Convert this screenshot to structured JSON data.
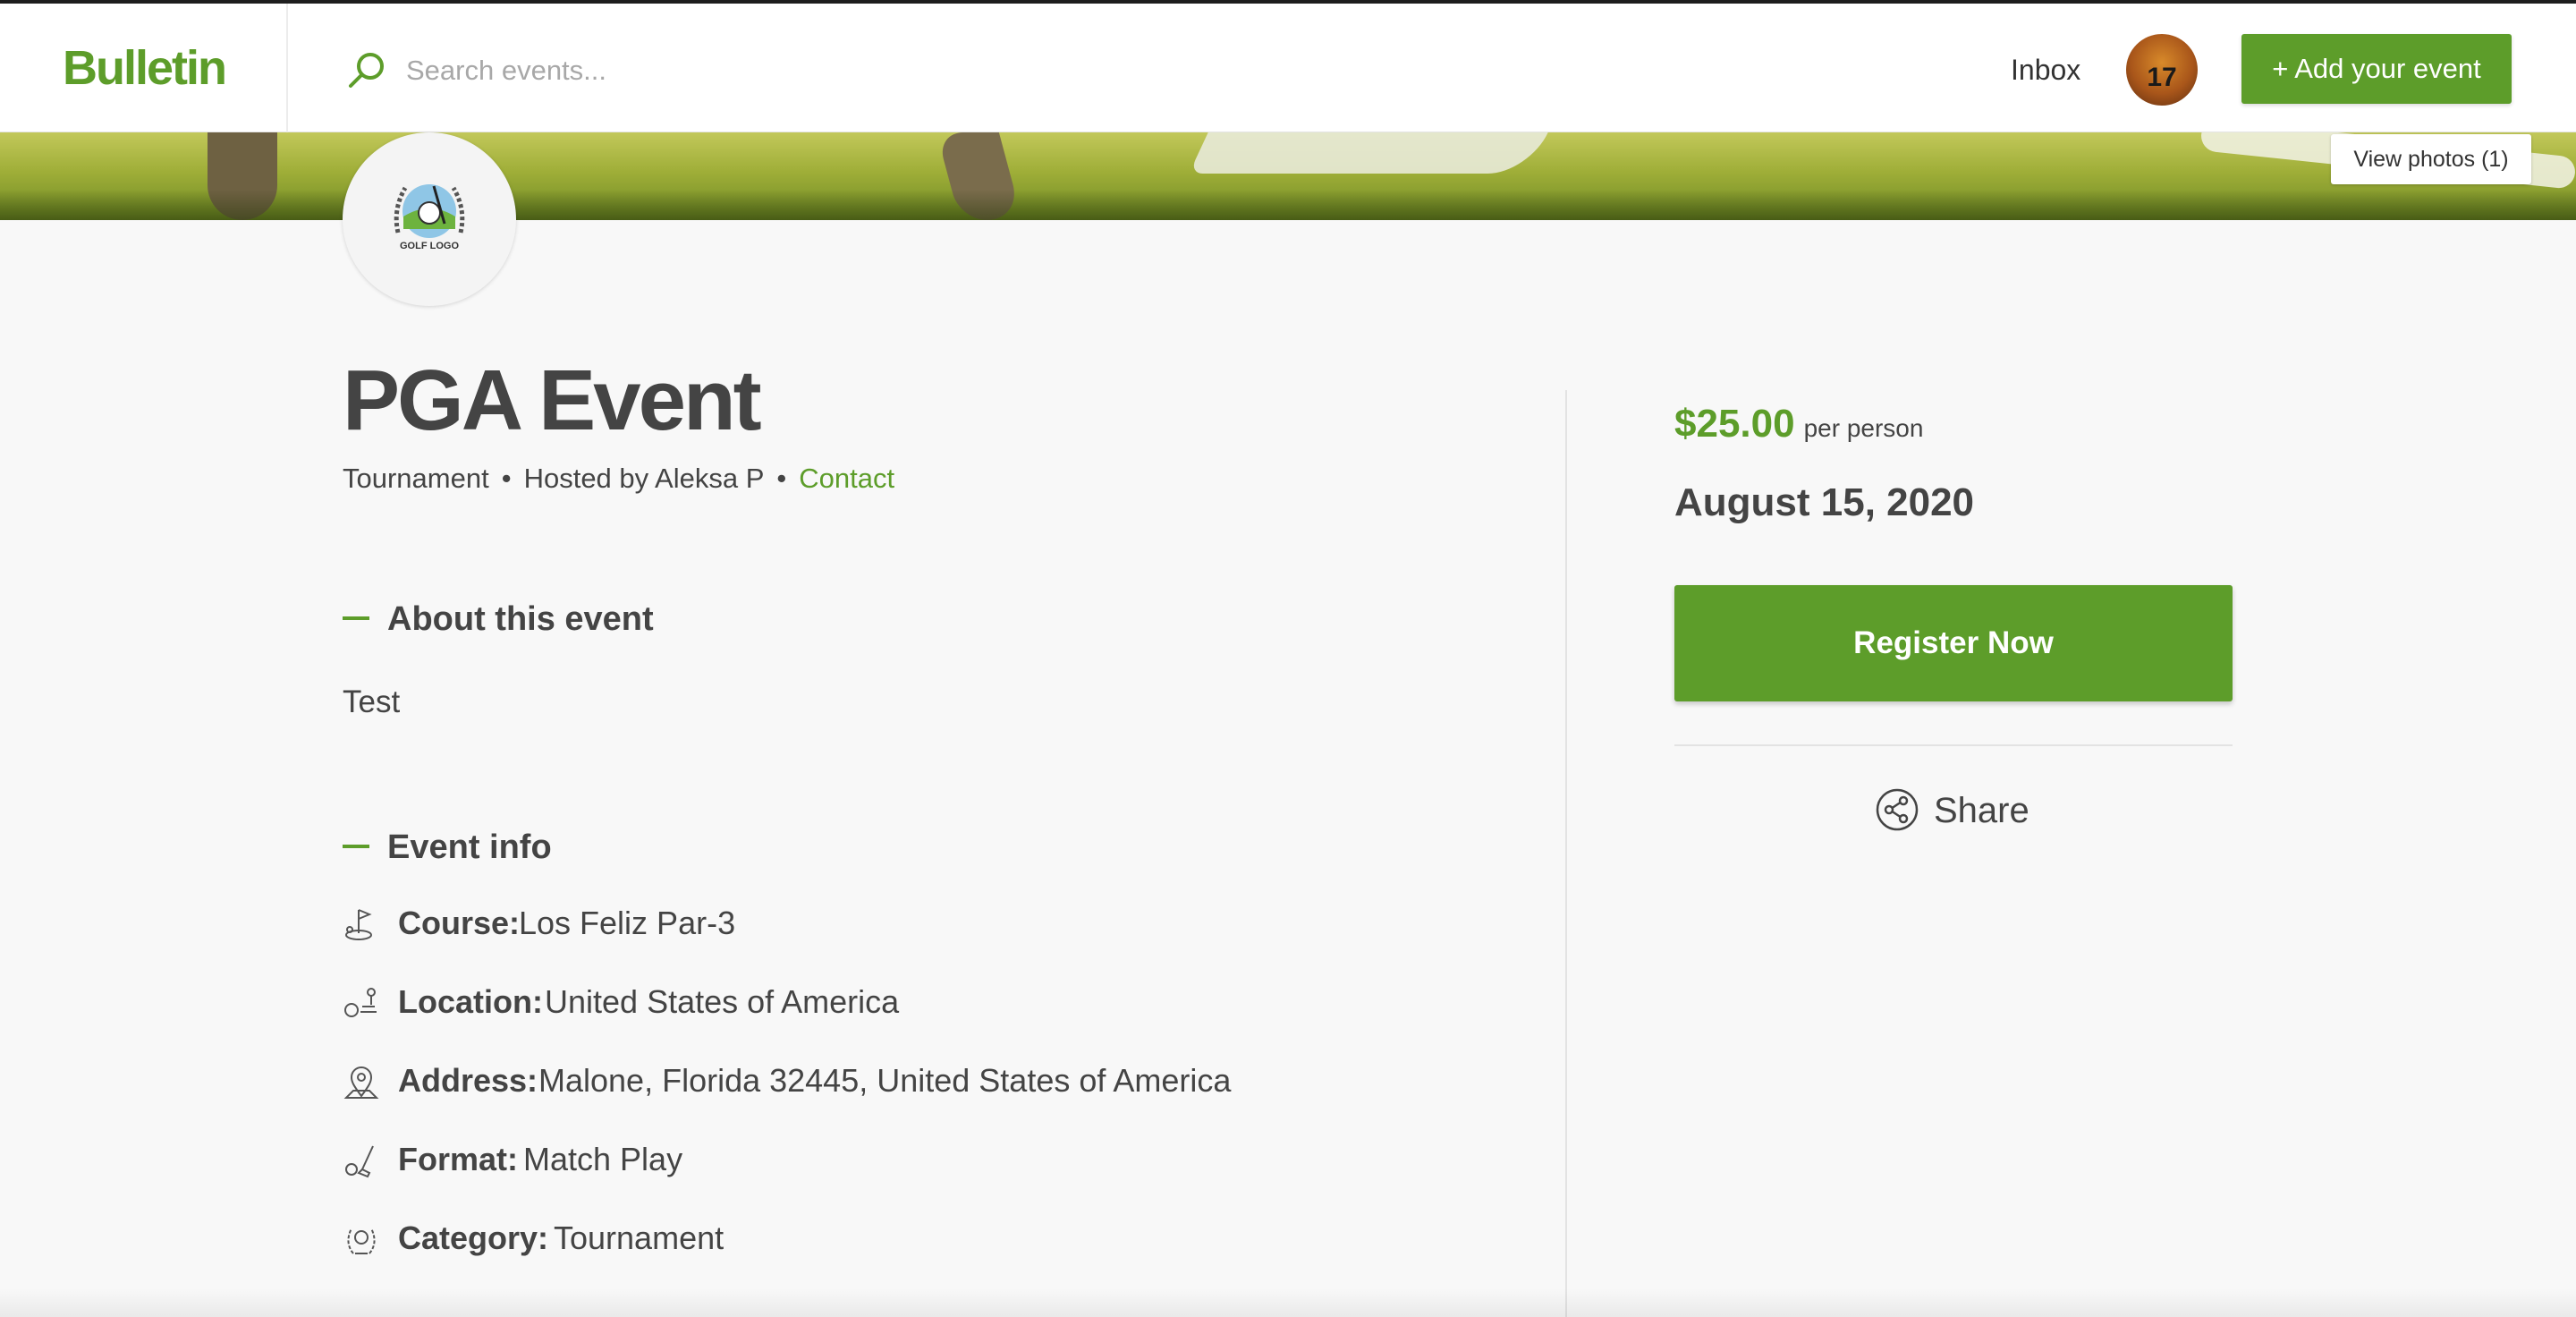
{
  "header": {
    "logo": "Bulletin",
    "search_placeholder": "Search events...",
    "inbox_label": "Inbox",
    "avatar_number": "17",
    "add_event_label": "+ Add your event"
  },
  "cover": {
    "view_photos_label": "View photos (1)",
    "logo_text": "GOLF LOGO"
  },
  "event": {
    "title": "PGA Event",
    "type": "Tournament",
    "hosted_by": "Hosted by Aleksa P",
    "contact_label": "Contact",
    "about_heading": "About this event",
    "about_text": "Test",
    "info_heading": "Event info",
    "info": [
      {
        "icon": "golf-flag-icon",
        "label": "Course:",
        "value": "Los Feliz Par-3"
      },
      {
        "icon": "golf-hole-icon",
        "label": "Location:",
        "value": "United States of America"
      },
      {
        "icon": "map-pin-icon",
        "label": "Address:",
        "value": "Malone, Florida 32445, United States of America"
      },
      {
        "icon": "golf-club-icon",
        "label": "Format:",
        "value": "Match Play"
      },
      {
        "icon": "laurel-icon",
        "label": "Category:",
        "value": "Tournament"
      }
    ]
  },
  "sidebar": {
    "price": "$25.00",
    "price_unit": "per person",
    "date": "August 15, 2020",
    "register_label": "Register Now",
    "share_label": "Share"
  },
  "colors": {
    "accent": "#5d9d2a",
    "text": "#444444",
    "background": "#f8f8f8"
  }
}
